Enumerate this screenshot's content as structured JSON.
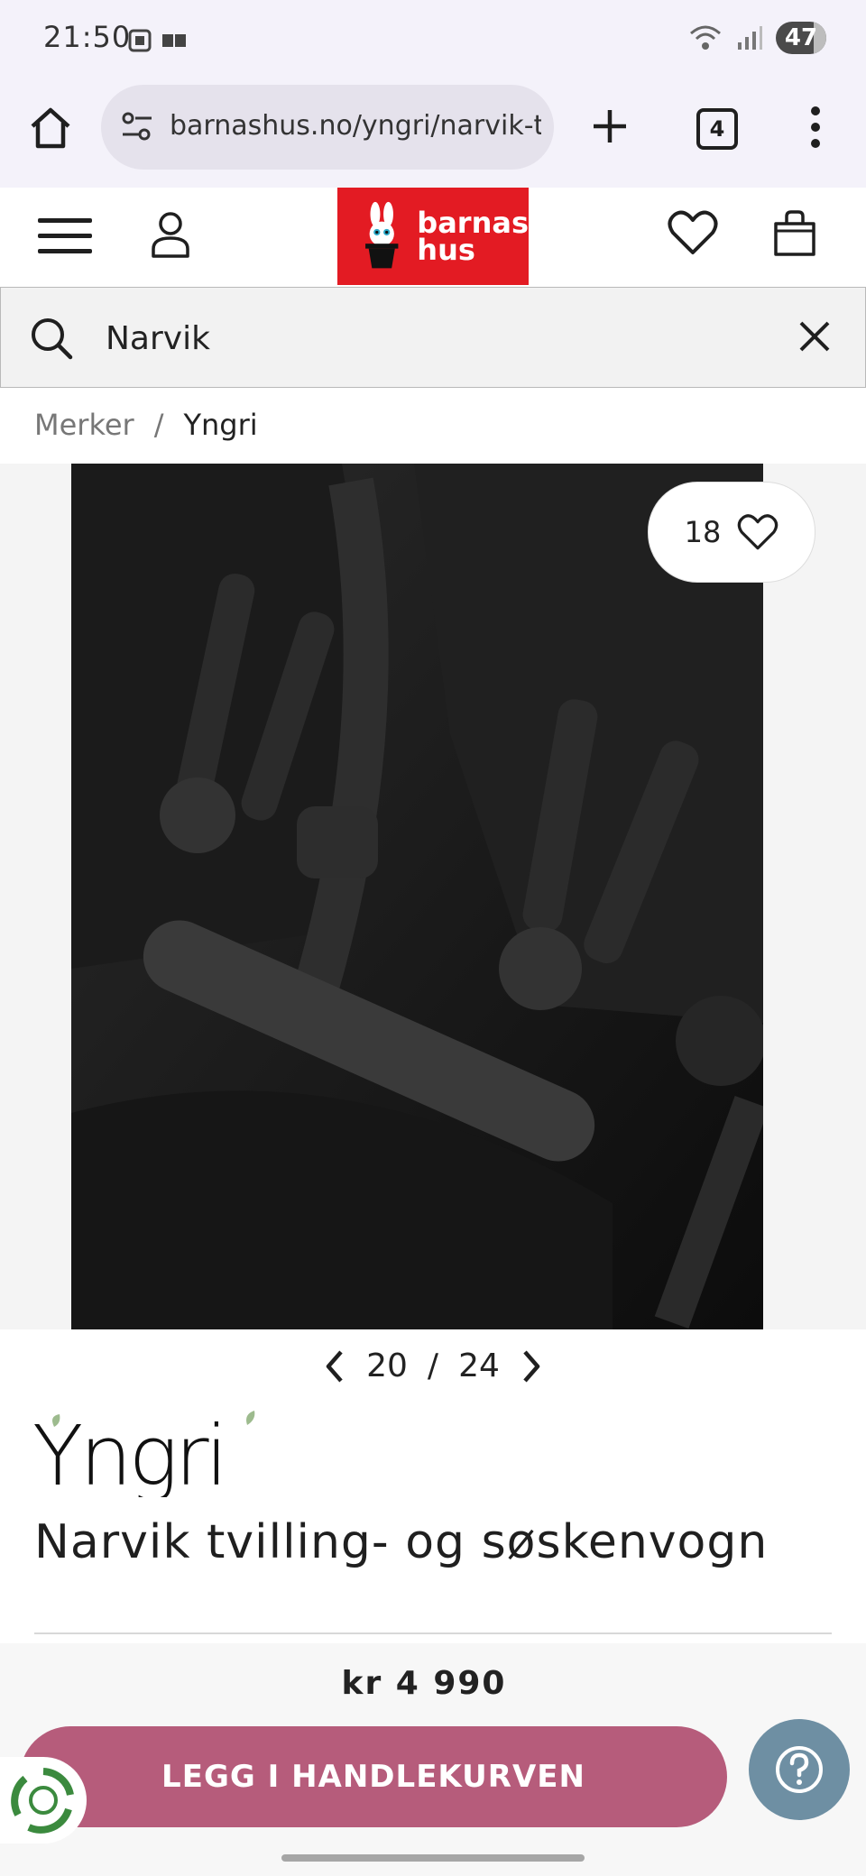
{
  "status_bar": {
    "time": "21:50",
    "battery": "47"
  },
  "browser": {
    "url": "barnashus.no/yngri/narvik-tvill",
    "tab_count": "4"
  },
  "header": {
    "logo_line1": "barnas",
    "logo_line2": "hus"
  },
  "search": {
    "value": "Narvik"
  },
  "breadcrumb": {
    "items": [
      "Merker",
      "/",
      "Yngri"
    ]
  },
  "gallery": {
    "favorite_count": "18",
    "current": "20",
    "separator": "/",
    "total": "24"
  },
  "product": {
    "brand": "Yngri",
    "title": "Narvik tvilling- og søskenvogn",
    "price": "kr 4 990"
  },
  "actions": {
    "add_to_cart": "LEGG I HANDLEKURVEN"
  },
  "colors": {
    "brand_red": "#e31b23",
    "cart_button": "#b65c7b",
    "help_button": "#6e8fa3"
  }
}
